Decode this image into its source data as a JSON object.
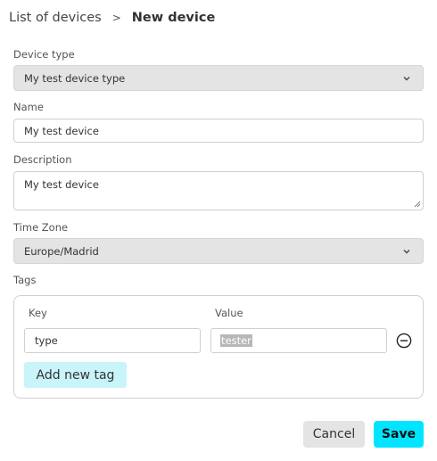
{
  "breadcrumb": {
    "parent": "List of devices",
    "separator": ">",
    "current": "New device"
  },
  "form": {
    "device_type": {
      "label": "Device type",
      "value": "My test device type"
    },
    "name": {
      "label": "Name",
      "value": "My test device"
    },
    "description": {
      "label": "Description",
      "value": "My test device"
    },
    "time_zone": {
      "label": "Time Zone",
      "value": "Europe/Madrid"
    },
    "tags": {
      "label": "Tags",
      "key_header": "Key",
      "value_header": "Value",
      "rows": [
        {
          "key": "type",
          "value": "tester"
        }
      ],
      "add_label": "Add new tag"
    }
  },
  "actions": {
    "cancel_label": "Cancel",
    "save_label": "Save"
  },
  "colors": {
    "save_button": "#00e5ff",
    "add_tag_button": "#c8f4fa",
    "select_background": "#e4e4e4"
  },
  "icons": {
    "select_chevron": "chevron-down-icon",
    "remove_tag": "minus-circle-icon",
    "textarea_grip": "resize-grip-icon"
  }
}
